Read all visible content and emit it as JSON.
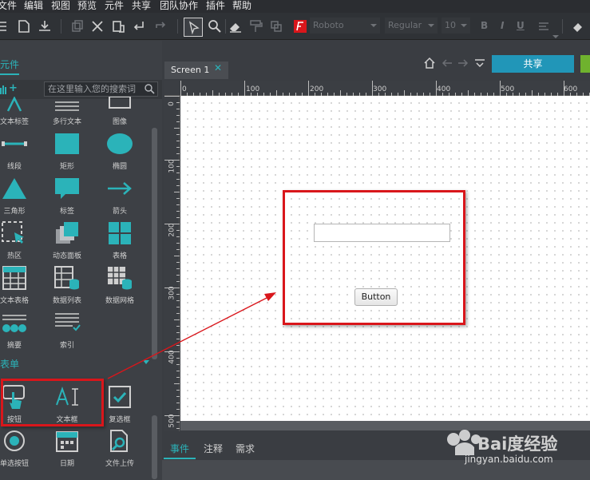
{
  "menubar": {
    "items": [
      "文件",
      "编辑",
      "视图",
      "预览",
      "元件",
      "共享",
      "团队协作",
      "插件",
      "帮助"
    ]
  },
  "toolbar": {
    "font_name": "Roboto",
    "font_style": "Regular",
    "font_size": "10",
    "bold": "B",
    "italic": "I",
    "underline": "U"
  },
  "left_panel": {
    "title": "元件",
    "search_placeholder": "在这里输入您的搜索词",
    "basic_widgets": [
      {
        "label": "文本标签",
        "icon": "text-label-icon"
      },
      {
        "label": "多行文本",
        "icon": "paragraph-icon"
      },
      {
        "label": "图像",
        "icon": "image-icon"
      },
      {
        "label": "线段",
        "icon": "line-icon"
      },
      {
        "label": "矩形",
        "icon": "rectangle-icon"
      },
      {
        "label": "椭圆",
        "icon": "ellipse-icon"
      },
      {
        "label": "三角形",
        "icon": "triangle-icon"
      },
      {
        "label": "标签",
        "icon": "callout-icon"
      },
      {
        "label": "箭头",
        "icon": "arrow-icon"
      },
      {
        "label": "热区",
        "icon": "hotspot-icon"
      },
      {
        "label": "动态面板",
        "icon": "dynamic-panel-icon"
      },
      {
        "label": "表格",
        "icon": "table-icon"
      },
      {
        "label": "文本表格",
        "icon": "text-table-icon"
      },
      {
        "label": "数据列表",
        "icon": "data-list-icon"
      },
      {
        "label": "数据网格",
        "icon": "data-grid-icon"
      },
      {
        "label": "摘要",
        "icon": "stepper-icon"
      },
      {
        "label": "索引",
        "icon": "index-icon"
      }
    ],
    "form_section": "表单",
    "form_widgets": [
      {
        "label": "按钮",
        "icon": "button-widget-icon"
      },
      {
        "label": "文本框",
        "icon": "text-field-icon"
      },
      {
        "label": "复选框",
        "icon": "checkbox-icon"
      },
      {
        "label": "单选按钮",
        "icon": "radio-icon"
      },
      {
        "label": "日期",
        "icon": "date-icon"
      },
      {
        "label": "文件上传",
        "icon": "file-upload-icon"
      }
    ]
  },
  "screen": {
    "tab_label": "Screen 1",
    "share_label": "共享"
  },
  "rulers": {
    "top": [
      "0",
      "100",
      "200",
      "300",
      "400",
      "500",
      "600"
    ],
    "left": [
      "0",
      "100",
      "200",
      "300",
      "400",
      "500"
    ]
  },
  "canvas": {
    "button_label": "Button"
  },
  "bottom_panel": {
    "tabs": [
      "事件",
      "注释",
      "需求"
    ]
  },
  "watermark": {
    "brand": "Bai度经验",
    "url": "jingyan.baidu.com"
  },
  "colors": {
    "accent": "#2bb3b9",
    "share": "#2196b8",
    "highlight": "#d9161b"
  }
}
